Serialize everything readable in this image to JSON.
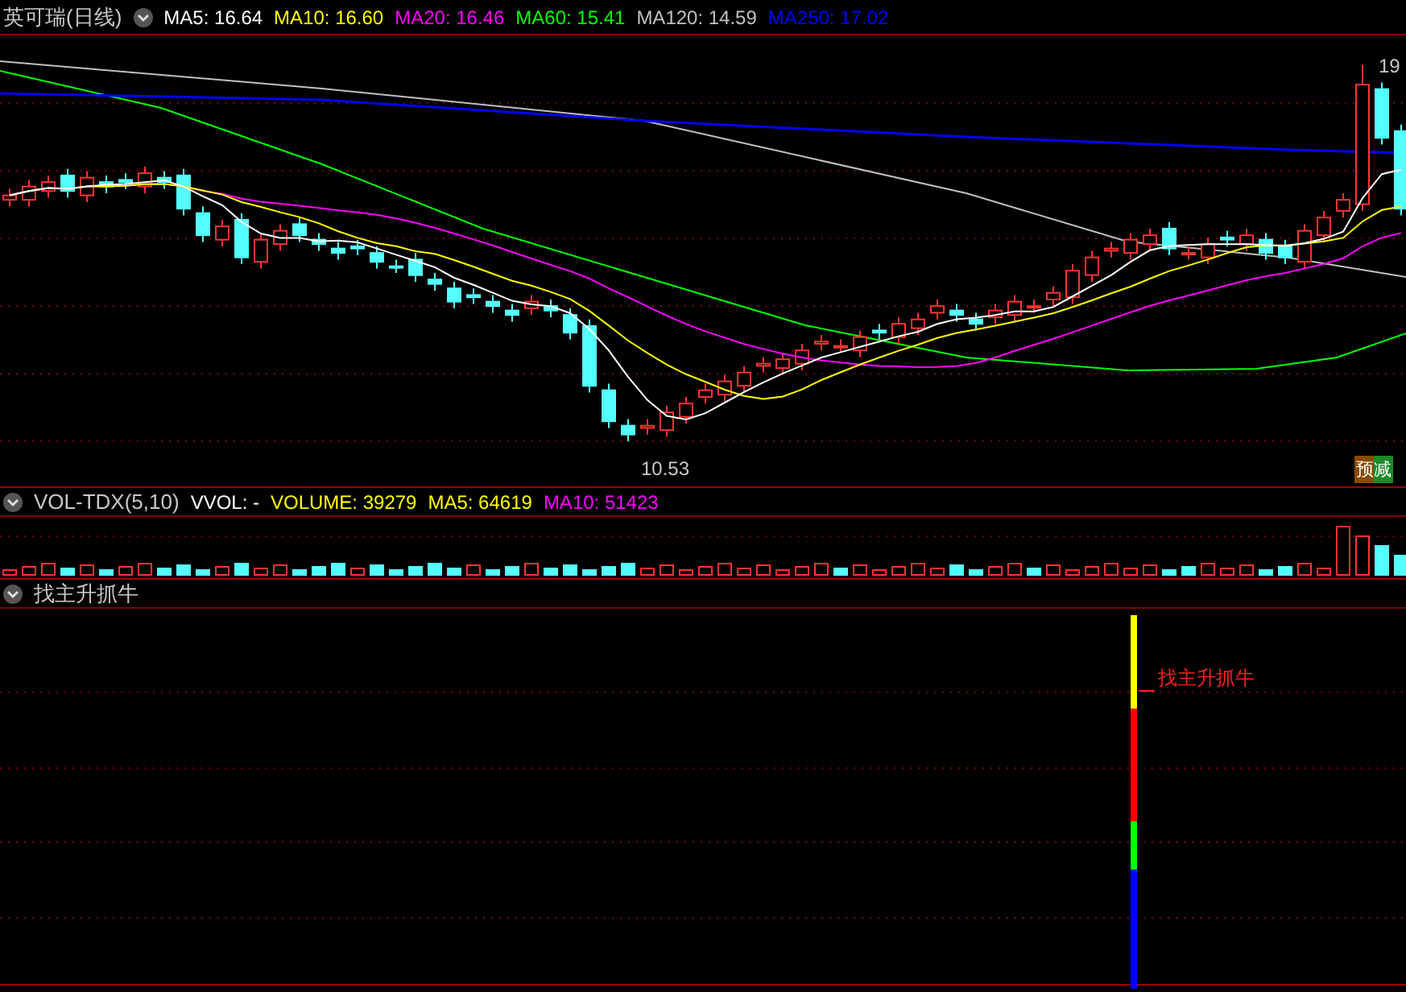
{
  "main_panel": {
    "title": "英可瑞(日线)",
    "indicators": [
      {
        "label": "MA5: 16.64",
        "color": "#ffffff"
      },
      {
        "label": "MA10: 16.60",
        "color": "#ffff00"
      },
      {
        "label": "MA20: 16.46",
        "color": "#ff00ff"
      },
      {
        "label": "MA60: 15.41",
        "color": "#00ff00"
      },
      {
        "label": "MA120: 14.59",
        "color": "#c0c0c0"
      },
      {
        "label": "MA250: 17.02",
        "color": "#0000ff"
      }
    ],
    "high_label": "19",
    "low_label": "10.53",
    "badge": "预减"
  },
  "volume_panel": {
    "title": "VOL-TDX(5,10)",
    "indicators": [
      {
        "label": "VVOL: -",
        "color": "#ffffff"
      },
      {
        "label": "VOLUME: 39279",
        "color": "#ffff00"
      },
      {
        "label": "MA5: 64619",
        "color": "#ffff00"
      },
      {
        "label": "MA10: 51423",
        "color": "#ff00ff"
      }
    ]
  },
  "signal_panel": {
    "title": "找主升抓牛",
    "signal_label": "找主升抓牛"
  }
}
